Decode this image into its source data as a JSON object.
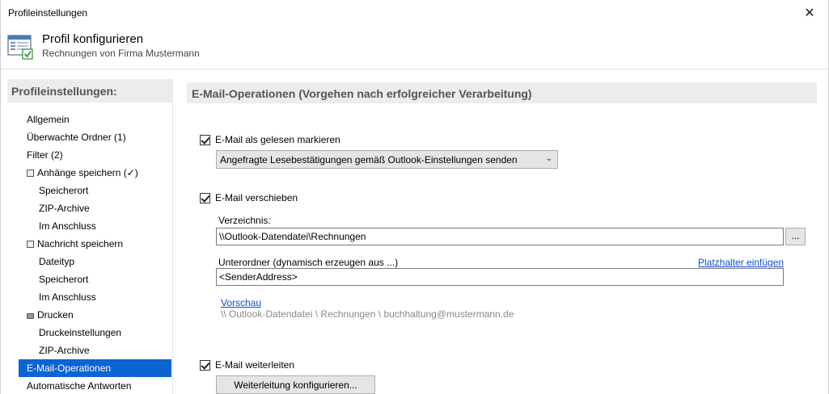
{
  "window": {
    "title": "Profileinstellungen"
  },
  "header": {
    "title": "Profil konfigurieren",
    "subtitle": "Rechnungen von Firma Mustermann"
  },
  "sidebar": {
    "title": "Profileinstellungen:",
    "items": [
      {
        "label": "Allgemein"
      },
      {
        "label": "Überwachte Ordner (1)"
      },
      {
        "label": "Filter (2)"
      },
      {
        "label": "Anhänge speichern (✓)"
      },
      {
        "label": "Speicherort"
      },
      {
        "label": "ZIP-Archive"
      },
      {
        "label": "Im Anschluss"
      },
      {
        "label": "Nachricht speichern"
      },
      {
        "label": "Dateityp"
      },
      {
        "label": "Speicherort"
      },
      {
        "label": "Im Anschluss"
      },
      {
        "label": "Drucken"
      },
      {
        "label": "Druckeinstellungen"
      },
      {
        "label": "ZIP-Archive"
      },
      {
        "label": "E-Mail-Operationen"
      },
      {
        "label": "Automatische Antworten"
      }
    ]
  },
  "main": {
    "section_title": "E-Mail-Operationen (Vorgehen nach erfolgreicher Verarbeitung)",
    "mark_read": {
      "label": "E-Mail als gelesen markieren",
      "checked": true,
      "select_value": "Angefragte Lesebestätigungen gemäß Outlook-Einstellungen senden"
    },
    "move": {
      "label": "E-Mail verschieben",
      "checked": true,
      "directory_label": "Verzeichnis:",
      "directory_value": "\\\\Outlook-Datendatei\\Rechnungen",
      "browse_label": "...",
      "subfolder_label": "Unterordner (dynamisch erzeugen aus ...)",
      "placeholder_link": "Platzhalter einfügen",
      "subfolder_value": "<SenderAddress>",
      "preview_link": "Vorschau",
      "preview_text": "\\\\ Outlook-Datendatei \\ Rechnungen \\ buchhaltung@mustermann.de"
    },
    "forward": {
      "label": "E-Mail weiterleiten",
      "checked": true,
      "button_label": "Weiterleitung konfigurieren..."
    }
  },
  "icons": {
    "close": "close-icon",
    "header": "profile-settings-icon"
  }
}
